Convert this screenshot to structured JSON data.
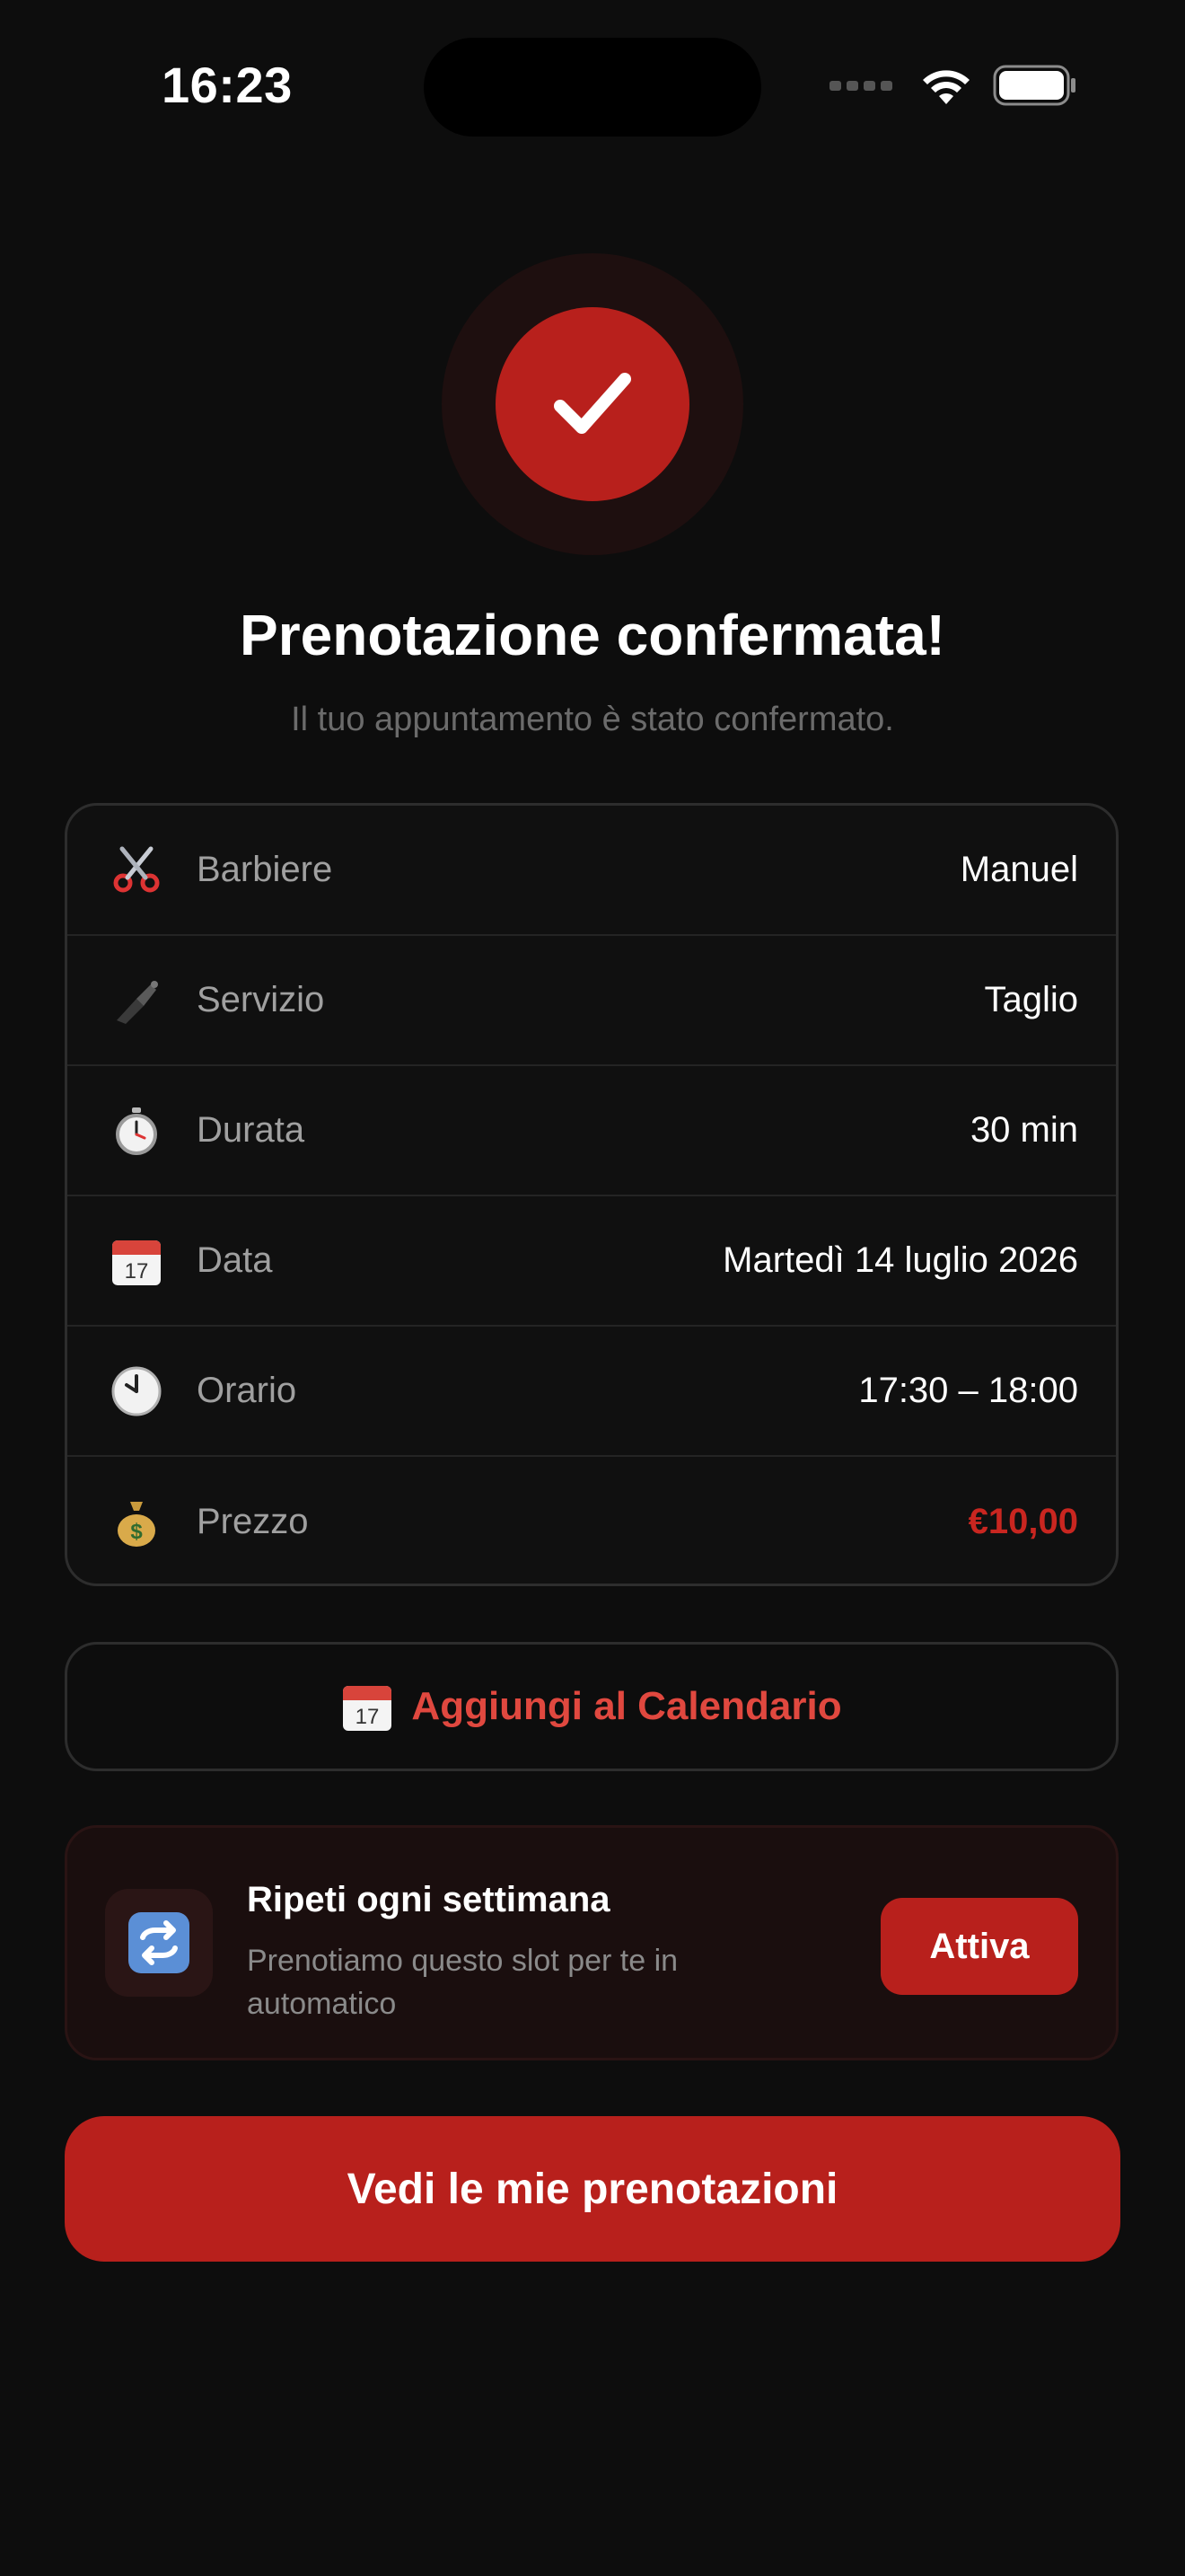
{
  "status_bar": {
    "time": "16:23"
  },
  "header": {
    "title": "Prenotazione confermata!",
    "subtitle": "Il tuo appuntamento è stato confermato."
  },
  "details": [
    {
      "icon": "scissors-icon",
      "label": "Barbiere",
      "value": "Manuel"
    },
    {
      "icon": "razor-icon",
      "label": "Servizio",
      "value": "Taglio"
    },
    {
      "icon": "stopwatch-icon",
      "label": "Durata",
      "value": "30 min"
    },
    {
      "icon": "calendar-icon",
      "label": "Data",
      "value": "Martedì 14 luglio 2026"
    },
    {
      "icon": "clock-icon",
      "label": "Orario",
      "value": "17:30 – 18:00"
    },
    {
      "icon": "money-bag-icon",
      "label": "Prezzo",
      "value": "€10,00"
    }
  ],
  "calendar_button": {
    "icon": "calendar-icon",
    "label": "Aggiungi al Calendario"
  },
  "repeat": {
    "icon": "repeat-icon",
    "title": "Ripeti ogni settimana",
    "description": "Prenotiamo questo slot per te in automatico",
    "button_label": "Attiva"
  },
  "primary_button": {
    "label": "Vedi le mie prenotazioni"
  },
  "colors": {
    "background": "#0d0d0d",
    "accent": "#b8201c",
    "price": "#c92620",
    "link": "#e0483f"
  }
}
